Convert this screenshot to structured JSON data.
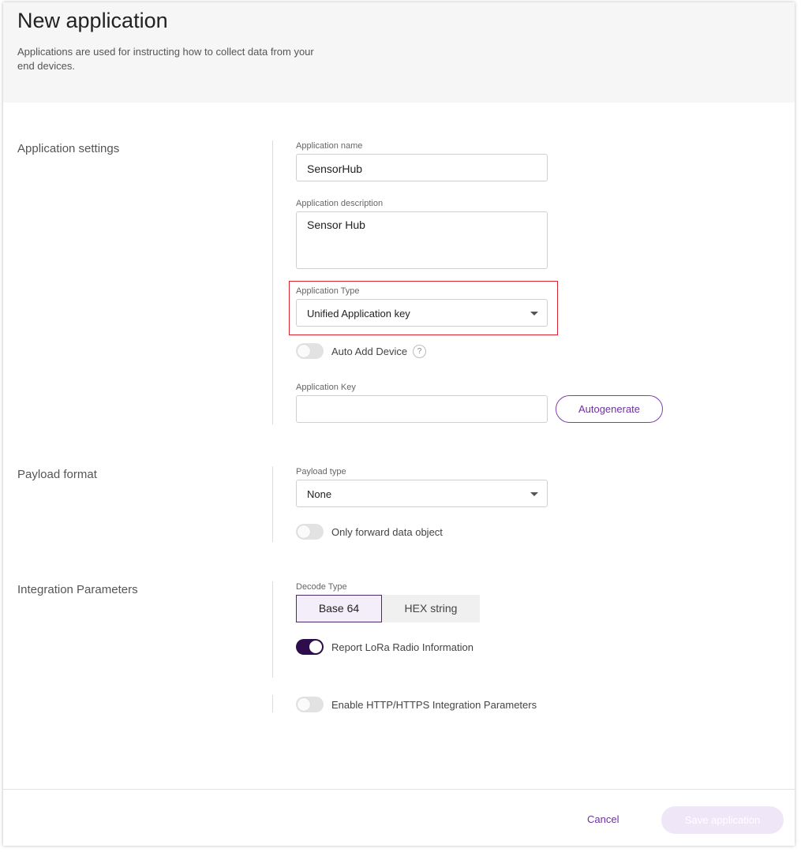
{
  "header": {
    "title": "New application",
    "subtitle": "Applications are used for instructing how to collect data from your end devices."
  },
  "sections": {
    "application_settings": "Application settings",
    "payload_format": "Payload format",
    "integration_parameters": "Integration Parameters"
  },
  "application": {
    "name_label": "Application name",
    "name_value": "SensorHub",
    "description_label": "Application description",
    "description_value": "Sensor Hub",
    "type_label": "Application Type",
    "type_value": "Unified Application key",
    "auto_add_label": "Auto Add Device",
    "auto_add_enabled": false,
    "help_glyph": "?",
    "key_label": "Application Key",
    "key_value": "",
    "autogenerate_label": "Autogenerate"
  },
  "payload": {
    "type_label": "Payload type",
    "type_value": "None",
    "forward_label": "Only forward data object",
    "forward_enabled": false
  },
  "integration": {
    "decode_label": "Decode Type",
    "decode_options": [
      "Base 64",
      "HEX string"
    ],
    "decode_selected": "Base 64",
    "report_label": "Report LoRa Radio Information",
    "report_enabled": true,
    "http_label": "Enable HTTP/HTTPS Integration Parameters",
    "http_enabled": false
  },
  "footer": {
    "cancel_label": "Cancel",
    "save_label": "Save application"
  },
  "colors": {
    "accent": "#6e2fa6",
    "toggle_on": "#2e0d4d",
    "highlight_border": "#d9232e"
  },
  "icons": {
    "select_caret": "chevron-down-icon",
    "help": "help-icon"
  }
}
